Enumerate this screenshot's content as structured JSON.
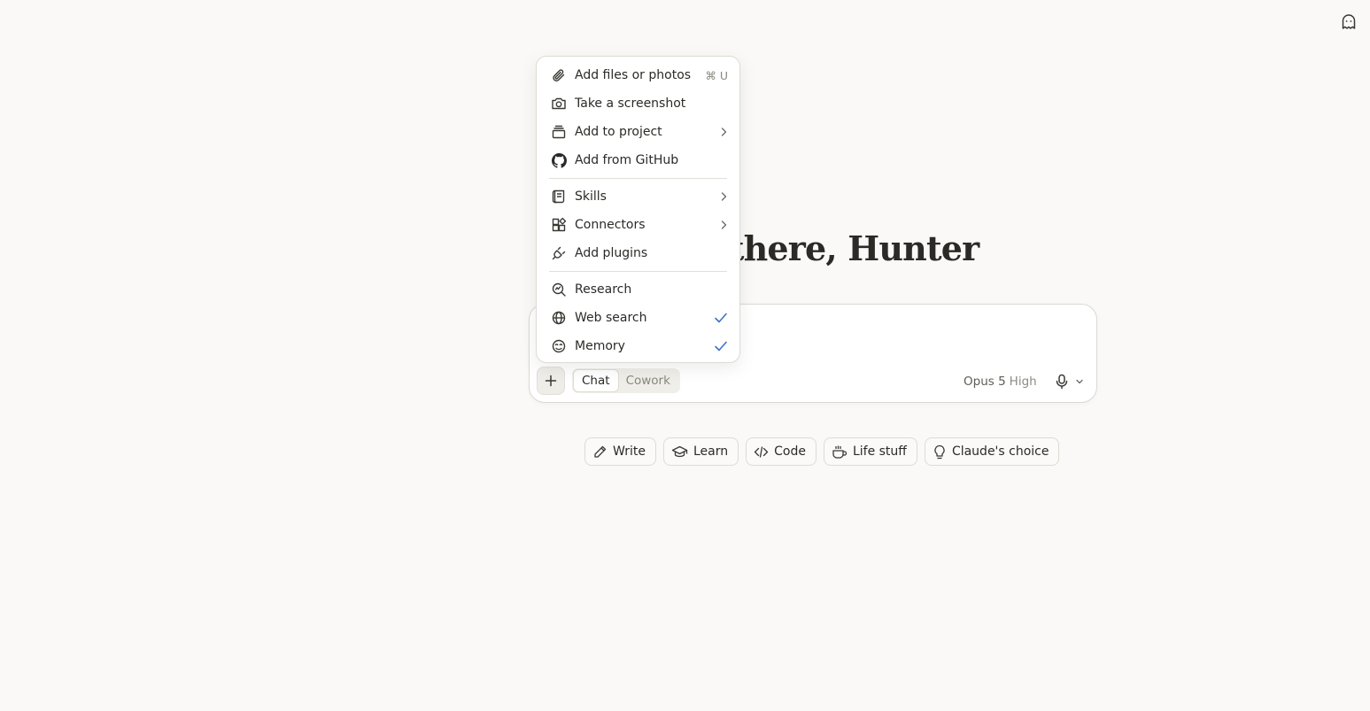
{
  "header": {
    "icon": "ghost-icon"
  },
  "greeting": {
    "text": "Hey there, Hunter"
  },
  "menu": {
    "items": [
      {
        "label": "Add files or photos",
        "icon": "paperclip-icon",
        "shortcut": "⌘ U"
      },
      {
        "label": "Take a screenshot",
        "icon": "camera-icon"
      },
      {
        "label": "Add to project",
        "icon": "project-icon",
        "submenu": true
      },
      {
        "label": "Add from GitHub",
        "icon": "github-icon"
      },
      {
        "label": "Skills",
        "icon": "skills-icon",
        "submenu": true
      },
      {
        "label": "Connectors",
        "icon": "connectors-icon",
        "submenu": true
      },
      {
        "label": "Add plugins",
        "icon": "plug-icon"
      },
      {
        "label": "Research",
        "icon": "research-icon"
      },
      {
        "label": "Web search",
        "icon": "globe-icon",
        "checked": true
      },
      {
        "label": "Memory",
        "icon": "memory-icon",
        "checked": true
      }
    ]
  },
  "composer": {
    "modes": [
      {
        "label": "Chat",
        "active": true
      },
      {
        "label": "Cowork",
        "active": false
      }
    ],
    "model": "Opus 5",
    "effort": "High"
  },
  "chips": [
    {
      "label": "Write",
      "icon": "pencil-icon"
    },
    {
      "label": "Learn",
      "icon": "graduation-cap-icon"
    },
    {
      "label": "Code",
      "icon": "code-icon"
    },
    {
      "label": "Life stuff",
      "icon": "coffee-icon"
    },
    {
      "label": "Claude's choice",
      "icon": "lightbulb-icon"
    }
  ],
  "colors": {
    "accent_check": "#3a73c8",
    "background": "#faf9f7"
  }
}
